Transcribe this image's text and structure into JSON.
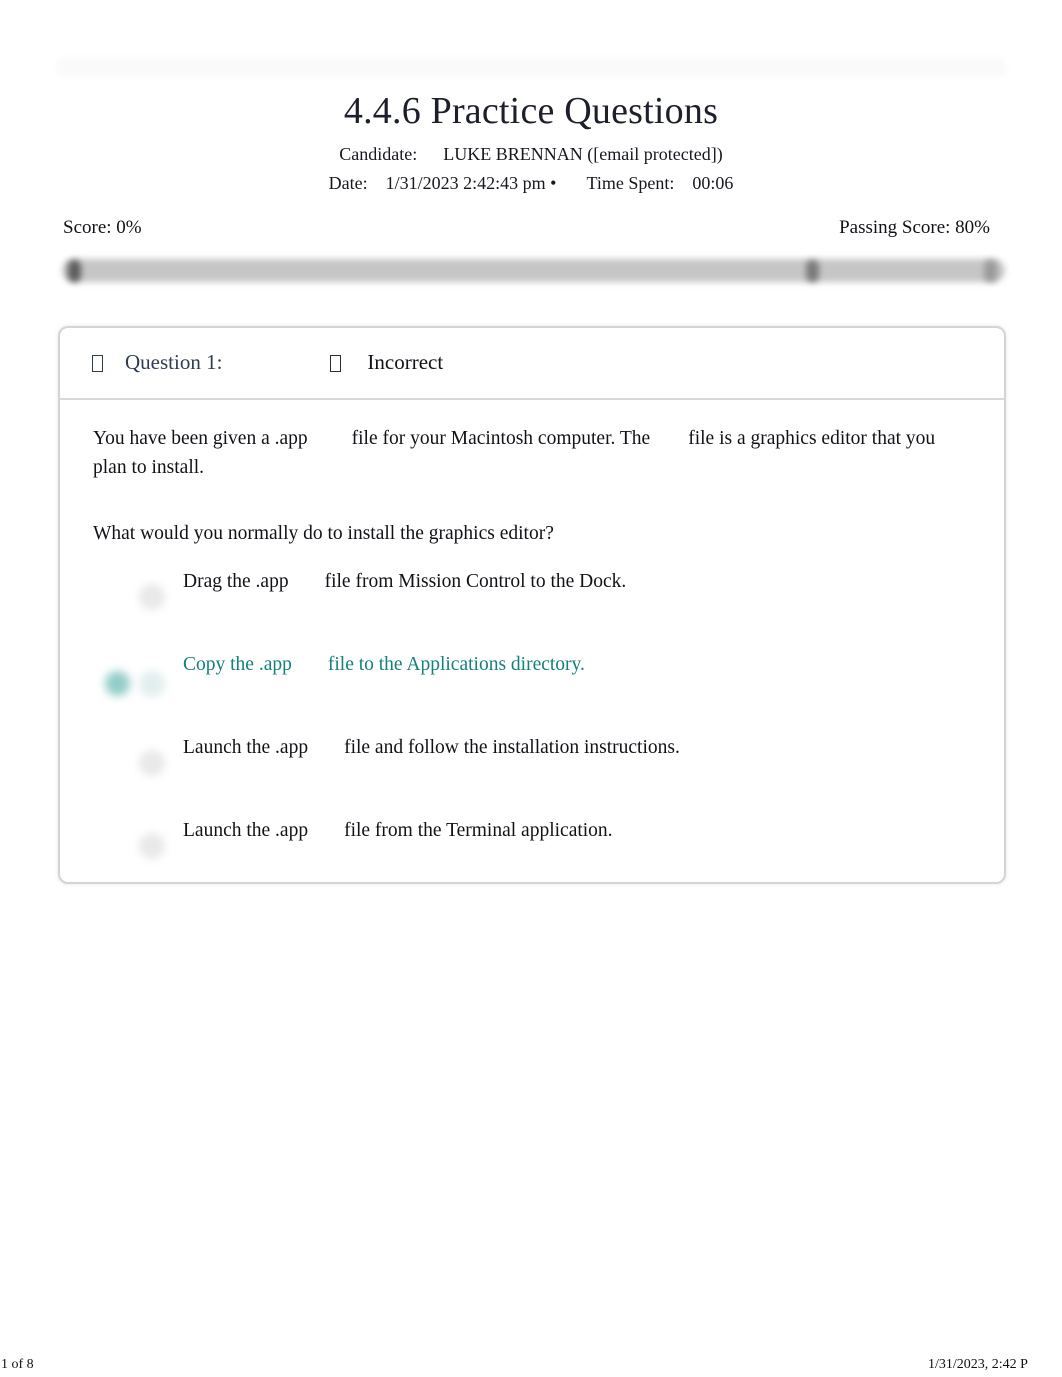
{
  "document": {
    "title": "4.4.6 Practice Questions",
    "candidate_label": "Candidate:",
    "candidate_value": "LUKE BRENNAN ([email protected])",
    "date_label": "Date:",
    "date_value": "1/31/2023 2:42:43 pm",
    "date_separator": "•",
    "time_spent_label": "Time Spent:",
    "time_spent_value": "00:06"
  },
  "score": {
    "score_label": "Score: 0%",
    "passing_score_label": "Passing Score: 80%",
    "score_percent": 0,
    "passing_percent": 80,
    "bar_color": "#c6c6c6",
    "marker_color": "#6f6f6f"
  },
  "question": {
    "tofu_glyph": "",
    "number_label": "Question 1:",
    "status_label": "Incorrect",
    "number_color": "#313b51",
    "status_color": "#111217",
    "stem_part_1": "You have been given a .app",
    "stem_part_2": "file for your Macintosh computer. The",
    "stem_part_3": "file is a graphics editor",
    "stem_part_4": "that you plan to install.",
    "prompt": "What would you normally do to install the graphics editor?",
    "correct_color": "#14807c",
    "options": [
      {
        "text_before": "Drag the .app",
        "text_after": "file from Mission Control to the Dock.",
        "correct": false,
        "selected": false
      },
      {
        "text_before": "Copy the .app",
        "text_after": "file to the Applications directory.",
        "correct": true,
        "selected": false
      },
      {
        "text_before": "Launch the .app",
        "text_after": "file and follow the installation instructions.",
        "correct": false,
        "selected": false
      },
      {
        "text_before": "Launch the .app",
        "text_after": "file from the Terminal application.",
        "correct": false,
        "selected": false
      }
    ]
  },
  "footer": {
    "page_indicator": "1 of 8",
    "timestamp": "1/31/2023, 2:42 P"
  }
}
